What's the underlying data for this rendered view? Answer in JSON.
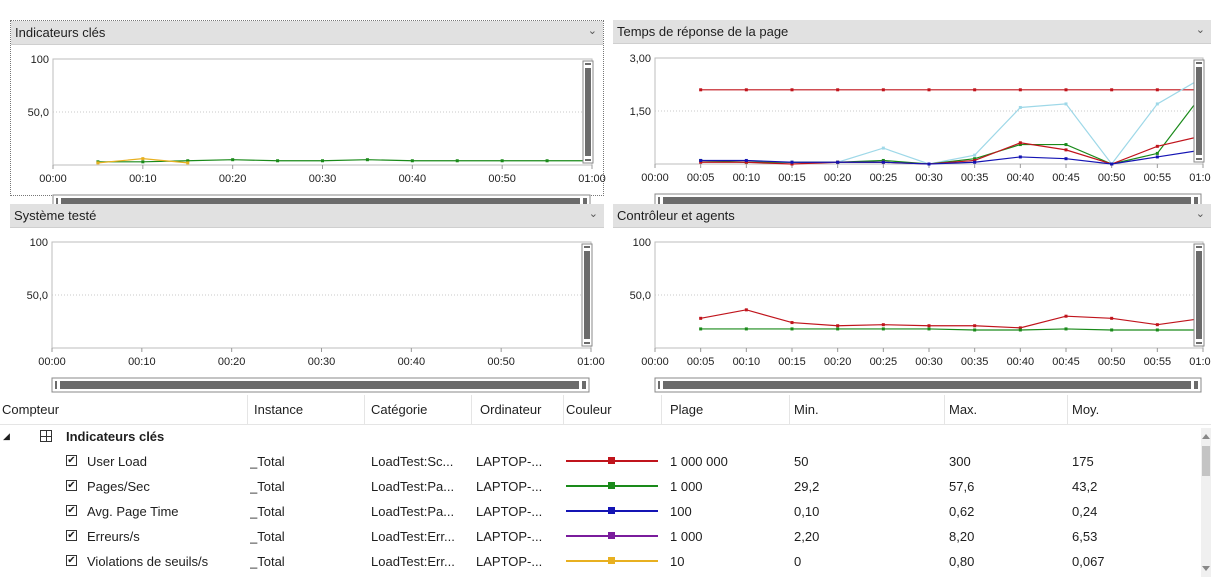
{
  "panels": [
    {
      "id": "kpi",
      "title": "Indicateurs clés",
      "chevron": "⌄"
    },
    {
      "id": "page",
      "title": "Temps de réponse de la page",
      "chevron": "⌄"
    },
    {
      "id": "sys",
      "title": "Système testé",
      "chevron": "⌄"
    },
    {
      "id": "ctrl",
      "title": "Contrôleur et agents",
      "chevron": "⌄"
    }
  ],
  "colors": {
    "red": "#c0141c",
    "green": "#1a8a1a",
    "blue": "#1414b4",
    "purple": "#7a1c9c",
    "yellow": "#e8b020",
    "lightblue": "#9ed8e8",
    "header_bg": "#e1e1e1",
    "scroll_thumb": "#6b6b6b"
  },
  "chart_data": [
    {
      "type": "line",
      "panel": "Indicateurs clés",
      "yticks": [
        "100",
        "50,0"
      ],
      "ylim": [
        0,
        100
      ],
      "xticks": [
        "00:00",
        "00:10",
        "00:20",
        "00:30",
        "00:40",
        "00:50",
        "01:00"
      ],
      "series": [
        {
          "color": "green",
          "x": [
            5,
            10,
            15,
            20,
            25,
            30,
            35,
            40,
            45,
            50,
            55,
            60
          ],
          "y": [
            3,
            3,
            4,
            5,
            4,
            4,
            5,
            4,
            4,
            4,
            4,
            4
          ]
        },
        {
          "color": "yellow",
          "x": [
            5,
            10,
            15
          ],
          "y": [
            2,
            6,
            2
          ]
        }
      ]
    },
    {
      "type": "line",
      "panel": "Temps de réponse de la page",
      "yticks": [
        "3,00",
        "1,50"
      ],
      "ylim": [
        0,
        3
      ],
      "xticks": [
        "00:00",
        "00:05",
        "00:10",
        "00:15",
        "00:20",
        "00:25",
        "00:30",
        "00:35",
        "00:40",
        "00:45",
        "00:50",
        "00:55",
        "01:00"
      ],
      "series": [
        {
          "color": "red",
          "x": [
            5,
            10,
            15,
            20,
            25,
            30,
            35,
            40,
            45,
            50,
            55,
            60
          ],
          "y": [
            2.1,
            2.1,
            2.1,
            2.1,
            2.1,
            2.1,
            2.1,
            2.1,
            2.1,
            2.1,
            2.1,
            2.1
          ]
        },
        {
          "color": "lightblue",
          "x": [
            5,
            10,
            15,
            20,
            25,
            30,
            35,
            40,
            45,
            50,
            55,
            60
          ],
          "y": [
            0.1,
            0.05,
            0.05,
            0.05,
            0.45,
            0.0,
            0.25,
            1.6,
            1.7,
            0.0,
            1.7,
            2.45
          ]
        },
        {
          "color": "green",
          "x": [
            5,
            10,
            15,
            20,
            25,
            30,
            35,
            40,
            45,
            50,
            55,
            60
          ],
          "y": [
            0.1,
            0.05,
            0.05,
            0.05,
            0.1,
            0.0,
            0.15,
            0.55,
            0.55,
            0.0,
            0.3,
            2.0
          ]
        },
        {
          "color": "red",
          "x": [
            5,
            10,
            15,
            20,
            25,
            30,
            35,
            40,
            45,
            50,
            55,
            60
          ],
          "y": [
            0.05,
            0.05,
            0.0,
            0.05,
            0.05,
            0.0,
            0.1,
            0.6,
            0.4,
            0.0,
            0.5,
            0.8
          ]
        },
        {
          "color": "blue",
          "x": [
            5,
            10,
            15,
            20,
            25,
            30,
            35,
            40,
            45,
            50,
            55,
            60
          ],
          "y": [
            0.1,
            0.1,
            0.05,
            0.05,
            0.05,
            0.0,
            0.05,
            0.2,
            0.15,
            0.0,
            0.2,
            0.4
          ]
        }
      ]
    },
    {
      "type": "line",
      "panel": "Système testé",
      "yticks": [
        "100",
        "50,0"
      ],
      "ylim": [
        0,
        100
      ],
      "xticks": [
        "00:00",
        "00:10",
        "00:20",
        "00:30",
        "00:40",
        "00:50",
        "01:00"
      ],
      "series": []
    },
    {
      "type": "line",
      "panel": "Contrôleur et agents",
      "yticks": [
        "100",
        "50,0"
      ],
      "ylim": [
        0,
        100
      ],
      "xticks": [
        "00:00",
        "00:05",
        "00:10",
        "00:15",
        "00:20",
        "00:25",
        "00:30",
        "00:35",
        "00:40",
        "00:45",
        "00:50",
        "00:55",
        "01:00"
      ],
      "series": [
        {
          "color": "red",
          "x": [
            5,
            10,
            15,
            20,
            25,
            30,
            35,
            40,
            45,
            50,
            55,
            60
          ],
          "y": [
            28,
            36,
            24,
            21,
            22,
            21,
            21,
            19,
            30,
            28,
            22,
            28
          ]
        },
        {
          "color": "green",
          "x": [
            5,
            10,
            15,
            20,
            25,
            30,
            35,
            40,
            45,
            50,
            55,
            60
          ],
          "y": [
            18,
            18,
            18,
            18,
            18,
            18,
            17,
            17,
            18,
            17,
            17,
            17
          ]
        }
      ]
    }
  ],
  "table": {
    "headers": [
      "Compteur",
      "Instance",
      "Catégorie",
      "Ordinateur",
      "Couleur",
      "Plage",
      "Min.",
      "Max.",
      "Moy."
    ],
    "group": {
      "expand": "◢",
      "label": "Indicateurs clés"
    },
    "rows": [
      {
        "checked": "✔",
        "counter": "User Load",
        "instance": "_Total",
        "category": "LoadTest:Sc...",
        "computer": "LAPTOP-...",
        "color": "red",
        "range": "1 000 000",
        "min": "50",
        "max": "300",
        "avg": "175"
      },
      {
        "checked": "✔",
        "counter": "Pages/Sec",
        "instance": "_Total",
        "category": "LoadTest:Pa...",
        "computer": "LAPTOP-...",
        "color": "green",
        "range": "1 000",
        "min": "29,2",
        "max": "57,6",
        "avg": "43,2"
      },
      {
        "checked": "✔",
        "counter": "Avg. Page Time",
        "instance": "_Total",
        "category": "LoadTest:Pa...",
        "computer": "LAPTOP-...",
        "color": "blue",
        "range": "100",
        "min": "0,10",
        "max": "0,62",
        "avg": "0,24"
      },
      {
        "checked": "✔",
        "counter": "Erreurs/s",
        "instance": "_Total",
        "category": "LoadTest:Err...",
        "computer": "LAPTOP-...",
        "color": "purple",
        "range": "1 000",
        "min": "2,20",
        "max": "8,20",
        "avg": "6,53"
      },
      {
        "checked": "✔",
        "counter": "Violations de seuils/s",
        "instance": "_Total",
        "category": "LoadTest:Err...",
        "computer": "LAPTOP-...",
        "color": "yellow",
        "range": "10",
        "min": "0",
        "max": "0,80",
        "avg": "0,067"
      }
    ]
  }
}
